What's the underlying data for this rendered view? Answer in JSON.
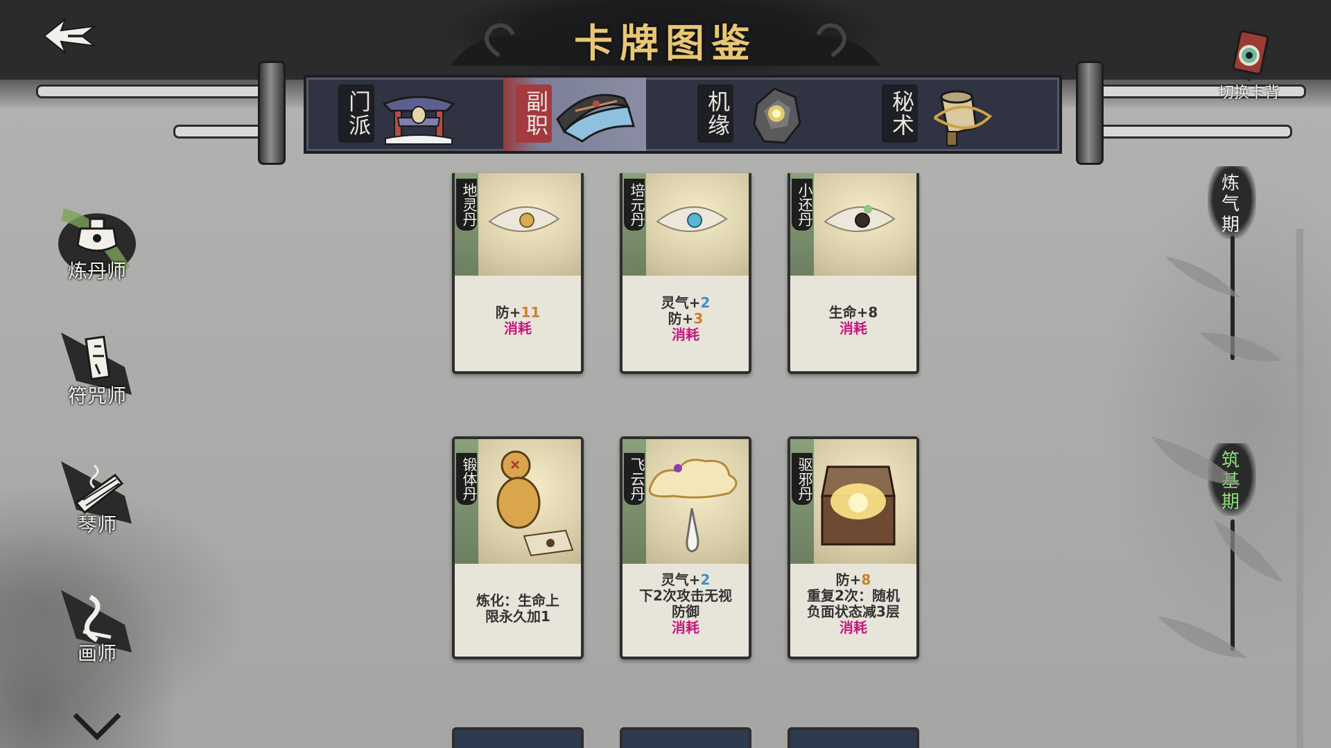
{
  "header": {
    "title": "卡牌图鉴",
    "back_icon": "back-arrow-icon"
  },
  "tabs": [
    {
      "label": "门派",
      "icon": "sect-gate-icon",
      "active": false
    },
    {
      "label": "副职",
      "icon": "hat-icon",
      "active": true
    },
    {
      "label": "机缘",
      "icon": "stone-icon",
      "active": false
    },
    {
      "label": "秘术",
      "icon": "scroll-icon",
      "active": false
    }
  ],
  "switch_back": {
    "label": "切换卡背",
    "icon": "card-back-icon"
  },
  "sidebar": {
    "items": [
      {
        "label": "炼丹师",
        "icon": "cauldron-icon",
        "active": true
      },
      {
        "label": "符咒师",
        "icon": "talisman-icon",
        "active": false
      },
      {
        "label": "琴师",
        "icon": "zither-icon",
        "active": false
      },
      {
        "label": "画师",
        "icon": "brush-icon",
        "active": false
      }
    ],
    "more_icon": "chevron-down-icon"
  },
  "realms": [
    {
      "label": "炼气期",
      "color": "#f0eee8"
    },
    {
      "label": "筑基期",
      "color": "#8fe07a"
    }
  ],
  "cards": [
    {
      "name": "地灵丹",
      "lines": [
        [
          [
            "防+",
            ""
          ],
          [
            "11",
            "orange"
          ]
        ],
        [
          [
            "消耗",
            "magenta"
          ]
        ]
      ]
    },
    {
      "name": "培元丹",
      "lines": [
        [
          [
            "灵气+",
            ""
          ],
          [
            "2",
            "blue"
          ]
        ],
        [
          [
            "防+",
            ""
          ],
          [
            "3",
            "orange"
          ]
        ],
        [
          [
            "消耗",
            "magenta"
          ]
        ]
      ]
    },
    {
      "name": "小还丹",
      "lines": [
        [
          [
            "生命+8",
            ""
          ]
        ],
        [
          [
            "消耗",
            "magenta"
          ]
        ]
      ]
    },
    {
      "name": "锻体丹",
      "lines": [
        [
          [
            "炼化：生命上",
            ""
          ]
        ],
        [
          [
            "限永久加1",
            ""
          ]
        ]
      ]
    },
    {
      "name": "飞云丹",
      "lines": [
        [
          [
            "灵气+",
            ""
          ],
          [
            "2",
            "blue"
          ]
        ],
        [
          [
            "下2次攻击无视",
            ""
          ]
        ],
        [
          [
            "防御",
            ""
          ]
        ],
        [
          [
            "消耗",
            "magenta"
          ]
        ]
      ]
    },
    {
      "name": "驱邪丹",
      "lines": [
        [
          [
            "防+",
            ""
          ],
          [
            "8",
            "orange"
          ]
        ],
        [
          [
            "重复2次：随机",
            ""
          ]
        ],
        [
          [
            "负面状态减3层",
            ""
          ]
        ],
        [
          [
            "消耗",
            "magenta"
          ]
        ]
      ]
    }
  ],
  "colors": {
    "gold_title": "#e8c774",
    "value_orange": "#c9822a",
    "value_blue": "#3d8fd1",
    "keyword_magenta": "#c2187b",
    "tab_active_red": "#a33a3d"
  }
}
